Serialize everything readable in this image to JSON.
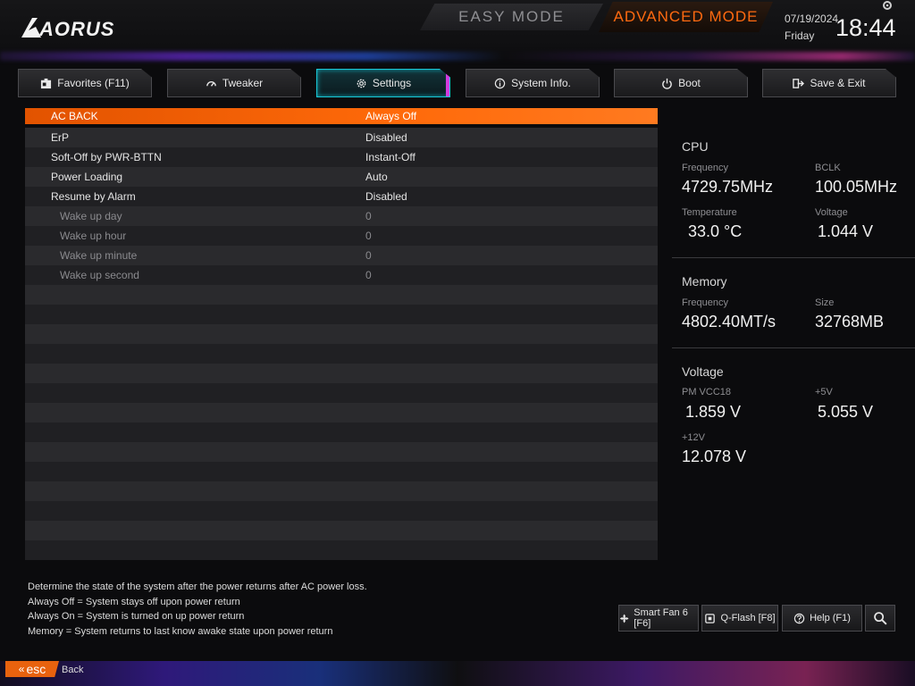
{
  "header": {
    "brand": "AORUS",
    "easy_mode": "EASY MODE",
    "advanced_mode": "ADVANCED MODE",
    "date": "07/19/2024",
    "day": "Friday",
    "time": "18:44"
  },
  "tabs": [
    {
      "label": "Favorites (F11)",
      "icon": "favorites-icon"
    },
    {
      "label": "Tweaker",
      "icon": "gauge-icon"
    },
    {
      "label": "Settings",
      "icon": "gear-icon",
      "active": true
    },
    {
      "label": "System Info.",
      "icon": "info-icon"
    },
    {
      "label": "Boot",
      "icon": "power-icon"
    },
    {
      "label": "Save & Exit",
      "icon": "exit-icon"
    }
  ],
  "settings": [
    {
      "name": "AC BACK",
      "value": "Always Off"
    },
    {
      "name": "ErP",
      "value": "Disabled"
    },
    {
      "name": "Soft-Off by PWR-BTTN",
      "value": "Instant-Off"
    },
    {
      "name": "Power Loading",
      "value": "Auto"
    },
    {
      "name": "Resume by Alarm",
      "value": "Disabled"
    },
    {
      "name": "Wake up day",
      "value": "0"
    },
    {
      "name": "Wake up hour",
      "value": "0"
    },
    {
      "name": "Wake up minute",
      "value": "0"
    },
    {
      "name": "Wake up second",
      "value": "0"
    }
  ],
  "info": {
    "cpu": {
      "title": "CPU",
      "frequency_label": "Frequency",
      "frequency": "4729.75MHz",
      "bclk_label": "BCLK",
      "bclk": "100.05MHz",
      "temperature_label": "Temperature",
      "temperature": "33.0 °C",
      "voltage_label": "Voltage",
      "voltage": "1.044 V"
    },
    "memory": {
      "title": "Memory",
      "frequency_label": "Frequency",
      "frequency": "4802.40MT/s",
      "size_label": "Size",
      "size": "32768MB"
    },
    "voltage": {
      "title": "Voltage",
      "vcc18_label": "PM VCC18",
      "vcc18": "1.859 V",
      "v5_label": "+5V",
      "v5": "5.055 V",
      "v12_label": "+12V",
      "v12": "12.078 V"
    }
  },
  "help": {
    "line1": "Determine the state of  the system after the power returns after AC power loss.",
    "line2": "Always Off = System stays off upon power return",
    "line3": "Always On = System is turned on up power return",
    "line4": "Memory = System returns to last know awake state upon power return"
  },
  "bottom_buttons": {
    "smart_fan": "Smart Fan 6 [F6]",
    "qflash": "Q-Flash [F8]",
    "help": "Help (F1)"
  },
  "footer": {
    "esc": "esc",
    "back": "Back"
  },
  "colors": {
    "accent": "#ff6a10",
    "active_tab": "#19c8d6",
    "highlight_row": "#ff6a0a"
  }
}
